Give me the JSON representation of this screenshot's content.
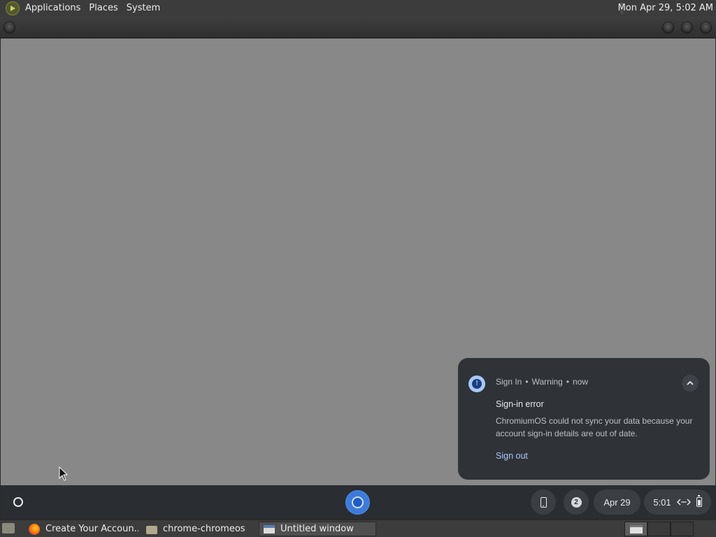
{
  "top_panel": {
    "menus": [
      "Applications",
      "Places",
      "System"
    ],
    "clock": "Mon Apr 29,  5:02 AM",
    "logo_icon": "gnome-foot-icon"
  },
  "notification": {
    "app": "Sign In",
    "severity": "Warning",
    "time": "now",
    "title": "Sign-in error",
    "body": "ChromiumOS could not sync your data because your account sign-in details are out of date.",
    "action": "Sign out",
    "icon": "info-icon",
    "accent_color": "#a8c7fa"
  },
  "shelf": {
    "launcher_icon": "launcher-icon",
    "pinned_app": "chromium-icon",
    "phone_hub_icon": "phone-icon",
    "notification_count": "2",
    "date": "Apr 29",
    "time": "5:01",
    "status_icons": [
      "network-icon",
      "battery-icon"
    ]
  },
  "taskbar": {
    "tasks": [
      {
        "label": "Create Your Accoun...",
        "icon": "firefox-icon",
        "active": false
      },
      {
        "label": "chrome-chromeos",
        "icon": "folder-icon",
        "active": false
      },
      {
        "label": "Untitled window",
        "icon": "window-icon",
        "active": true
      }
    ]
  },
  "window_content_color": "#888888"
}
